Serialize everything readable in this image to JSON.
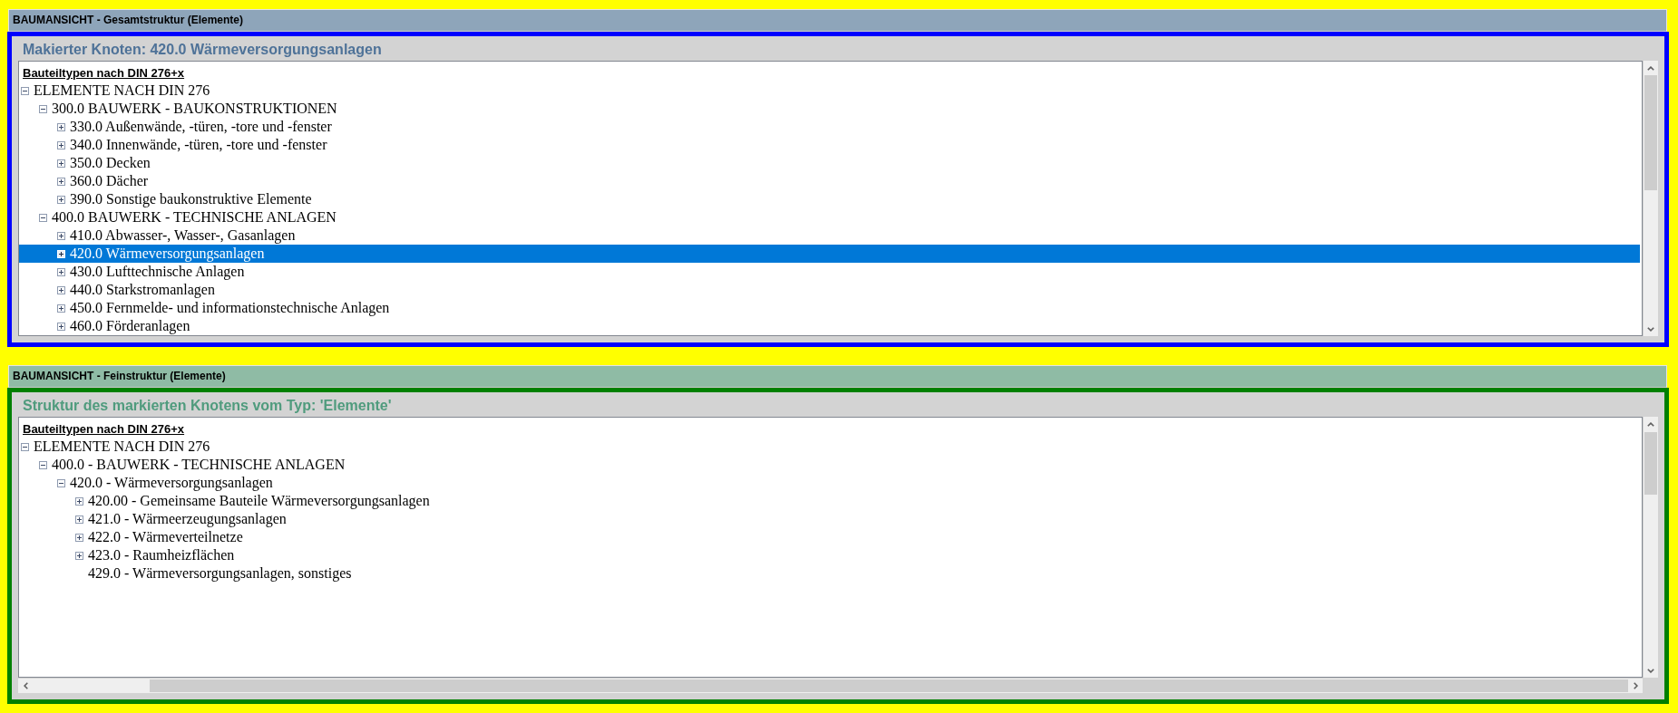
{
  "overall_view": {
    "header": "BAUMANSICHT - Gesamtstruktur (Elemente)",
    "title": "Makierter Knoten: 420.0 Wärmeversorgungsanlagen",
    "tree": {
      "heading": "Bauteiltypen nach DIN 276+x",
      "nodes": [
        {
          "label": "ELEMENTE NACH DIN 276",
          "kind": "branch",
          "expanded": true,
          "selected": false,
          "children": [
            {
              "label": "300.0 BAUWERK - BAUKONSTRUKTIONEN",
              "kind": "branch",
              "expanded": true,
              "selected": false,
              "children": [
                {
                  "label": "330.0 Außenwände, -türen, -tore und -fenster",
                  "kind": "branch",
                  "expanded": false,
                  "selected": false
                },
                {
                  "label": "340.0 Innenwände, -türen, -tore und -fenster",
                  "kind": "branch",
                  "expanded": false,
                  "selected": false
                },
                {
                  "label": "350.0 Decken",
                  "kind": "branch",
                  "expanded": false,
                  "selected": false
                },
                {
                  "label": "360.0 Dächer",
                  "kind": "branch",
                  "expanded": false,
                  "selected": false
                },
                {
                  "label": "390.0 Sonstige baukonstruktive Elemente",
                  "kind": "branch",
                  "expanded": false,
                  "selected": false
                }
              ]
            },
            {
              "label": "400.0 BAUWERK - TECHNISCHE ANLAGEN",
              "kind": "branch",
              "expanded": true,
              "selected": false,
              "children": [
                {
                  "label": "410.0 Abwasser-, Wasser-, Gasanlagen",
                  "kind": "branch",
                  "expanded": false,
                  "selected": false
                },
                {
                  "label": "420.0 Wärmeversorgungsanlagen",
                  "kind": "branch",
                  "expanded": false,
                  "selected": true
                },
                {
                  "label": "430.0 Lufttechnische Anlagen",
                  "kind": "branch",
                  "expanded": false,
                  "selected": false
                },
                {
                  "label": "440.0 Starkstromanlagen",
                  "kind": "branch",
                  "expanded": false,
                  "selected": false
                },
                {
                  "label": "450.0 Fernmelde- und informationstechnische Anlagen",
                  "kind": "branch",
                  "expanded": false,
                  "selected": false
                },
                {
                  "label": "460.0 Förderanlagen",
                  "kind": "branch",
                  "expanded": false,
                  "selected": false
                }
              ]
            }
          ]
        }
      ]
    }
  },
  "detail_view": {
    "header": "BAUMANSICHT - Feinstruktur (Elemente)",
    "title": "Struktur des markierten Knotens vom Typ: 'Elemente'",
    "tree": {
      "heading": "Bauteiltypen nach DIN 276+x",
      "nodes": [
        {
          "label": "ELEMENTE NACH DIN 276",
          "kind": "branch",
          "expanded": true,
          "selected": false,
          "children": [
            {
              "label": "400.0 - BAUWERK - TECHNISCHE ANLAGEN",
              "kind": "branch",
              "expanded": true,
              "selected": false,
              "children": [
                {
                  "label": "420.0 - Wärmeversorgungsanlagen",
                  "kind": "branch",
                  "expanded": true,
                  "selected": false,
                  "children": [
                    {
                      "label": "420.00 - Gemeinsame Bauteile Wärmeversorgungsanlagen",
                      "kind": "branch",
                      "expanded": false,
                      "selected": false
                    },
                    {
                      "label": "421.0 - Wärmeerzeugungsanlagen",
                      "kind": "branch",
                      "expanded": false,
                      "selected": false
                    },
                    {
                      "label": "422.0 - Wärmeverteilnetze",
                      "kind": "branch",
                      "expanded": false,
                      "selected": false
                    },
                    {
                      "label": "423.0 - Raumheizflächen",
                      "kind": "branch",
                      "expanded": false,
                      "selected": false
                    },
                    {
                      "label": "429.0 - Wärmeversorgungsanlagen, sonstiges",
                      "kind": "leaf",
                      "selected": false
                    }
                  ]
                }
              ]
            }
          ]
        }
      ]
    }
  }
}
